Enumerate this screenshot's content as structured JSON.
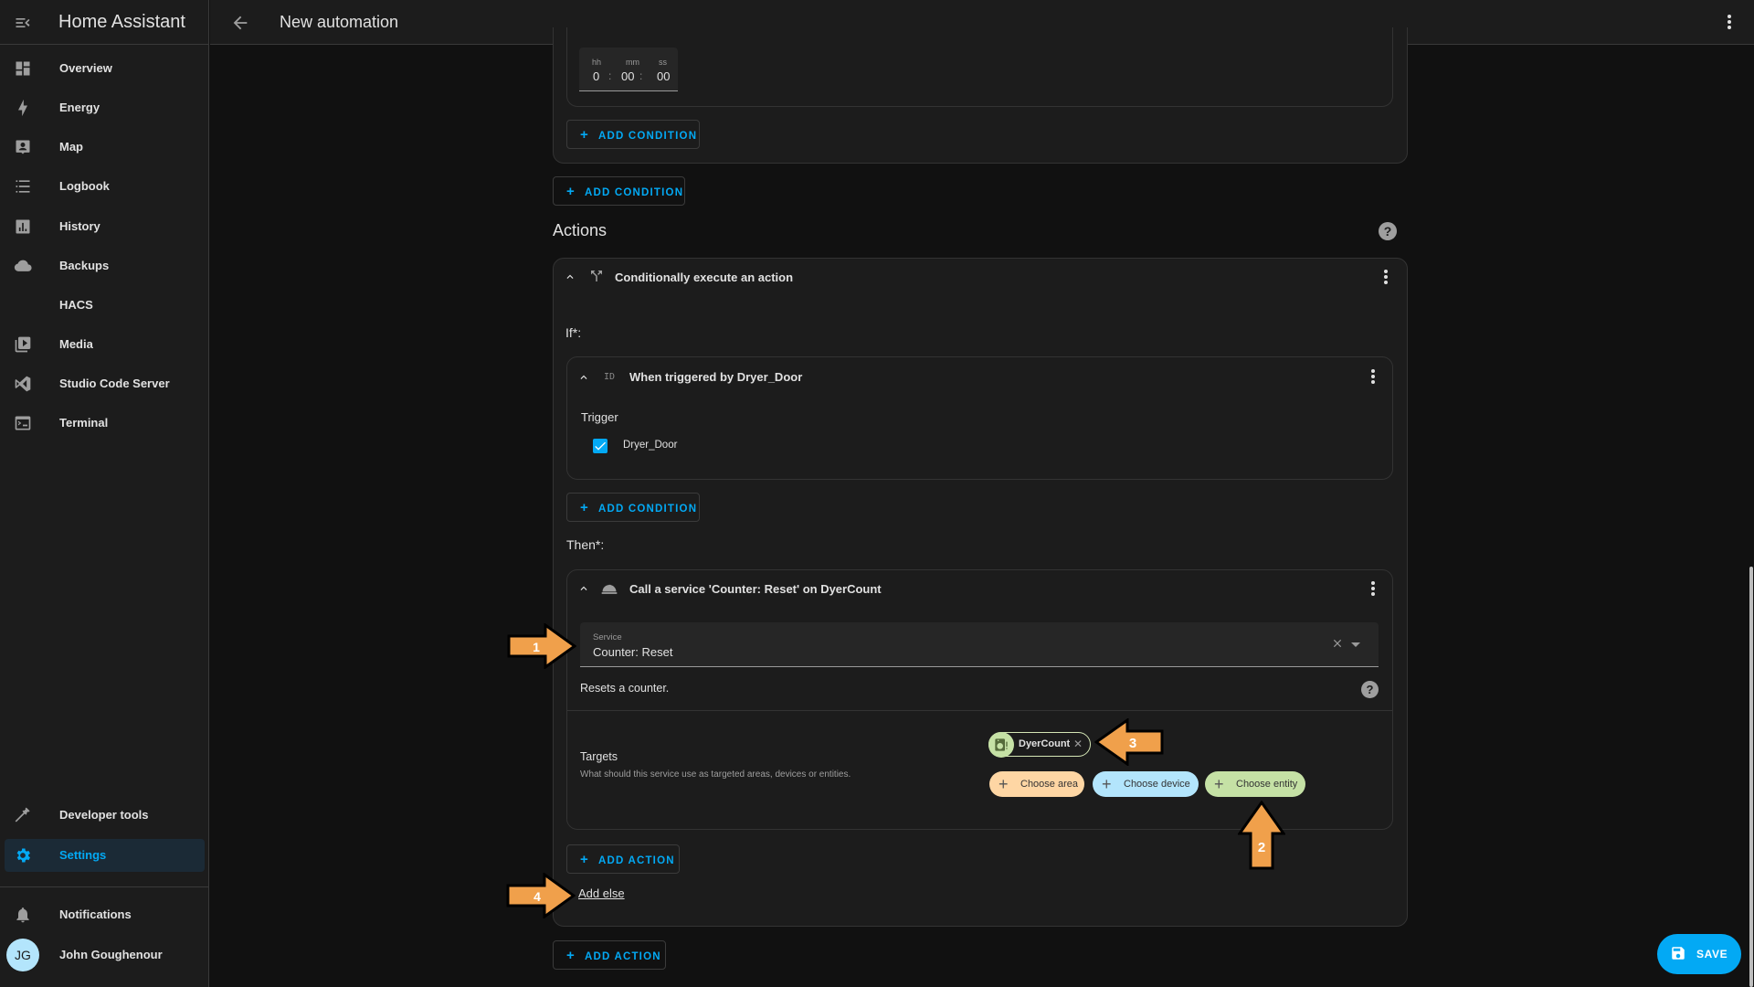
{
  "app": {
    "title": "Home Assistant"
  },
  "header": {
    "title": "New automation",
    "back_icon": "arrow-left-icon",
    "menu_icon": "dots-vertical-icon"
  },
  "sidebar": {
    "menu_icon": "menu-open-icon",
    "items": [
      {
        "label": "Overview",
        "icon": "view-dashboard-icon"
      },
      {
        "label": "Energy",
        "icon": "lightning-bolt-icon"
      },
      {
        "label": "Map",
        "icon": "account-box-icon"
      },
      {
        "label": "Logbook",
        "icon": "format-list-bulleted-icon"
      },
      {
        "label": "History",
        "icon": "chart-box-icon"
      },
      {
        "label": "Backups",
        "icon": "cloud-icon"
      },
      {
        "label": "HACS",
        "icon": ""
      },
      {
        "label": "Media",
        "icon": "play-box-multiple-icon"
      },
      {
        "label": "Studio Code Server",
        "icon": "vscode-icon"
      },
      {
        "label": "Terminal",
        "icon": "console-icon"
      }
    ],
    "bottom_items": [
      {
        "label": "Developer tools",
        "icon": "hammer-icon"
      },
      {
        "label": "Settings",
        "icon": "cog-icon",
        "active": true
      }
    ],
    "notifications": {
      "label": "Notifications",
      "icon": "bell-icon"
    },
    "user": {
      "name": "John Goughenour",
      "initials": "JG"
    }
  },
  "conditions": {
    "duration": {
      "hh_label": "hh",
      "mm_label": "mm",
      "ss_label": "ss",
      "hh": "0",
      "mm": "00",
      "ss": "00"
    },
    "inner_add_condition": "ADD CONDITION",
    "outer_add_condition": "ADD CONDITION"
  },
  "actions": {
    "title": "Actions",
    "choose_action": {
      "title": "Conditionally execute an action",
      "if_label": "If*:",
      "trigger_condition": {
        "title": "When triggered by Dryer_Door",
        "id_icon_text": "ID",
        "trigger_label": "Trigger",
        "trigger_option": "Dryer_Door",
        "checked": true
      },
      "add_condition": "ADD CONDITION",
      "then_label": "Then*:",
      "service_action": {
        "title": "Call a service 'Counter: Reset' on DyerCount",
        "service_field_label": "Service",
        "service_value": "Counter: Reset",
        "description": "Resets a counter.",
        "targets_title": "Targets",
        "targets_description": "What should this service use as targeted areas, devices or entities.",
        "selected_entity": "DyerCount",
        "choose_area": "Choose area",
        "choose_device": "Choose device",
        "choose_entity": "Choose entity"
      },
      "add_action": "ADD ACTION",
      "add_else": "Add else"
    },
    "add_action": "ADD ACTION"
  },
  "annotations": [
    {
      "number": "1",
      "target": "service-field"
    },
    {
      "number": "2",
      "target": "choose-entity"
    },
    {
      "number": "3",
      "target": "selected-entity"
    },
    {
      "number": "4",
      "target": "add-else"
    }
  ],
  "save_button": {
    "label": "SAVE"
  },
  "colors": {
    "accent": "#03a9f4",
    "annotation": "#f0a04b",
    "area_chip": "#fed6a4",
    "device_chip": "#b3e5fc",
    "entity_chip": "#c5e1a5"
  }
}
